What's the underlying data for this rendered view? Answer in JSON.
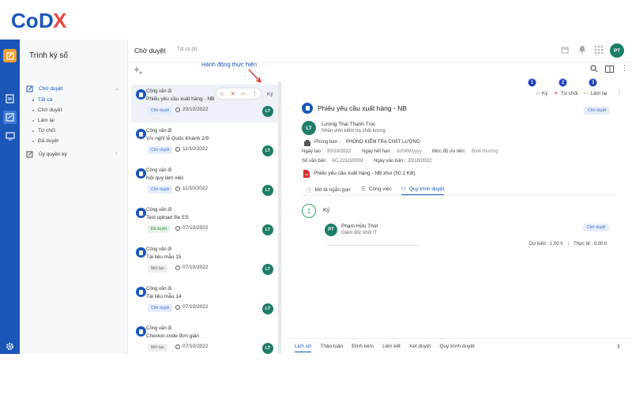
{
  "logo": {
    "text": "CODX"
  },
  "sidebar": {
    "title": "Trình ký số",
    "group_pending": "Chờ duyệt",
    "sub_items": [
      "Tất cả",
      "Chờ duyệt",
      "Làm lại",
      "Từ chối",
      "Đã duyệt"
    ],
    "group_delegate": "Ủy quyền ký"
  },
  "topbar": {
    "title": "Chờ duyệt",
    "tab_all": "Tất cả (8)",
    "user_initials": "PT"
  },
  "annotation": {
    "label": "Hành động thực hiện"
  },
  "list": {
    "hover_action": "Ký",
    "items": [
      {
        "type": "Công văn đi",
        "name": "Phiếu yêu cầu xuất hàng - NB",
        "status": "Chờ duyệt",
        "date": "20/10/2022",
        "avatar": "LT"
      },
      {
        "type": "Công văn đi",
        "name": "V/v nghỉ lễ Quốc Khánh 2/9",
        "status": "Chờ duyệt",
        "date": "11/10/2022",
        "avatar": "LT"
      },
      {
        "type": "Công văn đi",
        "name": "Nội quy làm việc",
        "status": "Chờ duyệt",
        "date": "11/10/2022",
        "avatar": "LT"
      },
      {
        "type": "Công văn đi",
        "name": "Test upload file ES",
        "status": "Đã duyệt",
        "date": "07/10/2022",
        "avatar": "LT"
      },
      {
        "type": "Công văn đi",
        "name": "Tài liệu mẫu 15",
        "status": "Mới tạo",
        "date": "07/10/2022",
        "avatar": "LT"
      },
      {
        "type": "Công văn đi",
        "name": "Tài liệu mẫu 14",
        "status": "Chờ duyệt",
        "date": "07/10/2022",
        "avatar": "LT"
      },
      {
        "type": "Công văn đi",
        "name": "Checkin-code đơn giản",
        "status": "Mới tạo",
        "date": "07/10/2022",
        "avatar": "LT"
      }
    ]
  },
  "detail": {
    "actions": {
      "n1": "1",
      "sign": "Ký",
      "n2": "2",
      "reject": "Từ chối",
      "n3": "3",
      "redo": "Làm lại"
    },
    "title": "Phiếu yêu cầu xuất hàng - NB",
    "status": "Chờ duyệt",
    "owner_initials": "LT",
    "owner_name": "Lương Thái Thanh Trúc",
    "owner_role": "Nhân viên kiểm tra chất lượng",
    "dept_label": "Phòng ban :",
    "dept_value": "PHÒNG KIỂM TRA CHẤT LƯỢNG",
    "created_label": "Ngày tạo :",
    "created_value": "20/10/2022",
    "expire_label": "Ngày hết hạn :",
    "expire_value": "dd/MM/yyyy",
    "priority_label": "Mức độ ưu tiên:",
    "priority_value": "Bình thường",
    "docno_label": "Số văn bản :",
    "docno_value": "AC-221020001",
    "docdate_label": "Ngày văn bản :",
    "docdate_value": "20/10/2022",
    "file": "Phiếu yêu cầu xuất hàng - NB.xlsx (50.1 KB)",
    "tabs": [
      "Mô tả ngắn gọn",
      "Công việc",
      "Quy trình duyệt"
    ],
    "step_num": "1",
    "step_name": "Ký",
    "signer_initials": "PT",
    "signer_name": "Phạm Hữu Thời",
    "signer_role": "Giám đốc khối IT",
    "signer_status": "Chờ duyệt",
    "expected": "Dự kiến : 1,00 h",
    "actual": "Thực tế : 0,00 h"
  },
  "bottom_tabs": [
    "Lịch sử",
    "Thảo luận",
    "Đính kèm",
    "Liên kết",
    "Xét duyệt",
    "Quy trình duyệt"
  ],
  "colors": {
    "primary": "#1a56b8",
    "logo_red": "#e8463f",
    "avatar": "#1e7d67"
  }
}
